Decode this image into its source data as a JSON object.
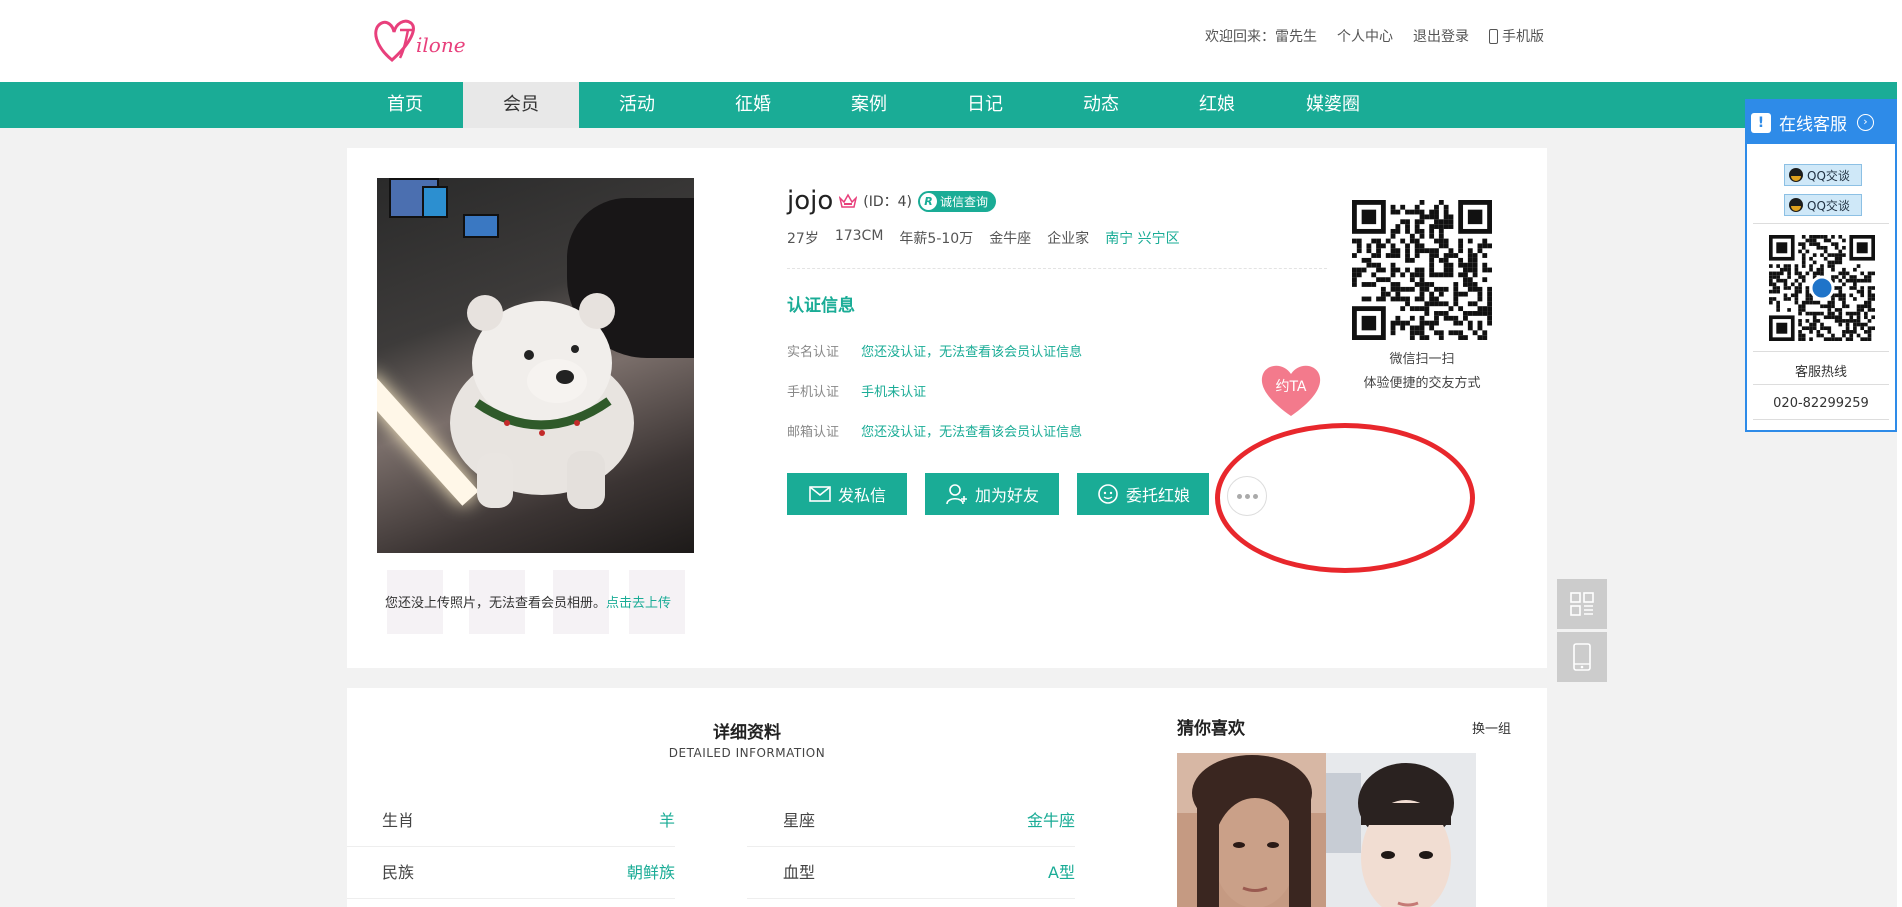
{
  "header": {
    "welcome": "欢迎回来：雷先生",
    "personal_center": "个人中心",
    "logout": "退出登录",
    "mobile": "手机版"
  },
  "nav": [
    "首页",
    "会员",
    "活动",
    "征婚",
    "案例",
    "日记",
    "动态",
    "红娘",
    "媒婆圈"
  ],
  "nav_active_index": 1,
  "profile": {
    "name": "jojo",
    "uid": "(ID：4)",
    "credit_badge": "诚信查询",
    "age": "27岁",
    "height": "173CM",
    "salary": "年薪5-10万",
    "zodiac": "金牛座",
    "job": "企业家",
    "location": "南宁 兴宁区",
    "upload_tip": "您还没上传照片，无法查看会员相册。",
    "upload_link": "点击去上传",
    "date_tag": "约TA"
  },
  "certification": {
    "title": "认证信息",
    "rows": [
      {
        "label": "实名认证",
        "value": "您还没认证，无法查看该会员认证信息"
      },
      {
        "label": "手机认证",
        "value": "手机未认证"
      },
      {
        "label": "邮箱认证",
        "value": "您还没认证，无法查看该会员认证信息"
      }
    ]
  },
  "actions": {
    "message": "发私信",
    "add_friend": "加为好友",
    "matchmaker": "委托红娘"
  },
  "wechat": {
    "line1": "微信扫一扫",
    "line2": "体验便捷的交友方式"
  },
  "details": {
    "title": "详细资料",
    "subtitle": "DETAILED INFORMATION",
    "items": [
      {
        "label": "生肖",
        "value": "羊"
      },
      {
        "label": "星座",
        "value": "金牛座"
      },
      {
        "label": "民族",
        "value": "朝鲜族"
      },
      {
        "label": "血型",
        "value": "A型"
      }
    ]
  },
  "guess": {
    "title": "猜你喜欢",
    "swap": "换一组"
  },
  "service": {
    "title": "在线客服",
    "qq1": "QQ交谈",
    "qq2": "QQ交谈",
    "hotline_label": "客服热线",
    "hotline": "020-82299259"
  },
  "colors": {
    "primary": "#1aac96",
    "service_blue": "#2e8be8",
    "highlight_red": "#e8272c"
  }
}
